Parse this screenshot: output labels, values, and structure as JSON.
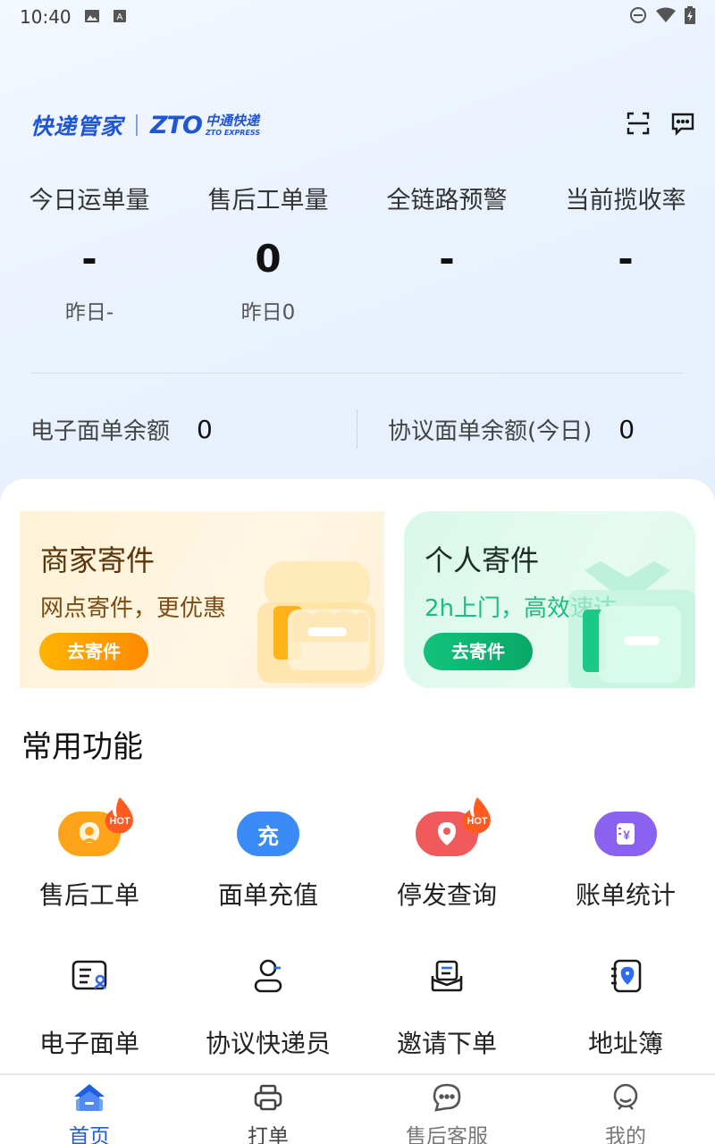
{
  "status_bar": {
    "time": "10:40"
  },
  "header": {
    "app_name": "快递管家",
    "brand_mark": "ZTO",
    "brand_cn": "中通快递",
    "brand_en": "ZTO EXPRESS",
    "icons": [
      "scan-icon",
      "message-icon"
    ]
  },
  "stats": [
    {
      "label": "今日运单量",
      "value": "-",
      "yesterday": "昨日-"
    },
    {
      "label": "售后工单量",
      "value": "0",
      "yesterday": "昨日0"
    },
    {
      "label": "全链路预警",
      "value": "-",
      "yesterday": ""
    },
    {
      "label": "当前揽收率",
      "value": "-",
      "yesterday": ""
    }
  ],
  "balances": [
    {
      "label": "电子面单余额",
      "value": "0"
    },
    {
      "label": "协议面单余额(今日)",
      "value": "0"
    }
  ],
  "cards": [
    {
      "title": "商家寄件",
      "subtitle": "网点寄件，更优惠",
      "button": "去寄件"
    },
    {
      "title": "个人寄件",
      "subtitle": "2h上门，高效速达",
      "button": "去寄件"
    }
  ],
  "section_title": "常用功能",
  "functions_row1": [
    {
      "label": "售后工单",
      "icon": "headset-icon",
      "hot": true,
      "color": "#ffa31a"
    },
    {
      "label": "面单充值",
      "icon": "recharge-icon",
      "icon_text": "充",
      "hot": false,
      "color": "#3a8bf5"
    },
    {
      "label": "停发查询",
      "icon": "location-pin-icon",
      "hot": true,
      "color": "#f05a5a"
    },
    {
      "label": "账单统计",
      "icon": "bill-icon",
      "hot": false,
      "color": "#8a62ef"
    }
  ],
  "functions_row2": [
    {
      "label": "电子面单",
      "icon": "e-waybill-icon"
    },
    {
      "label": "协议快递员",
      "icon": "courier-icon"
    },
    {
      "label": "邀请下单",
      "icon": "invite-order-icon"
    },
    {
      "label": "地址簿",
      "icon": "address-book-icon"
    }
  ],
  "hot_badge": "HOT",
  "tabs": [
    {
      "label": "首页",
      "icon": "home-icon",
      "active": true
    },
    {
      "label": "打单",
      "icon": "printer-icon",
      "active": false
    },
    {
      "label": "售后客服",
      "icon": "chat-icon",
      "active": false
    },
    {
      "label": "我的",
      "icon": "profile-icon",
      "active": false
    }
  ]
}
